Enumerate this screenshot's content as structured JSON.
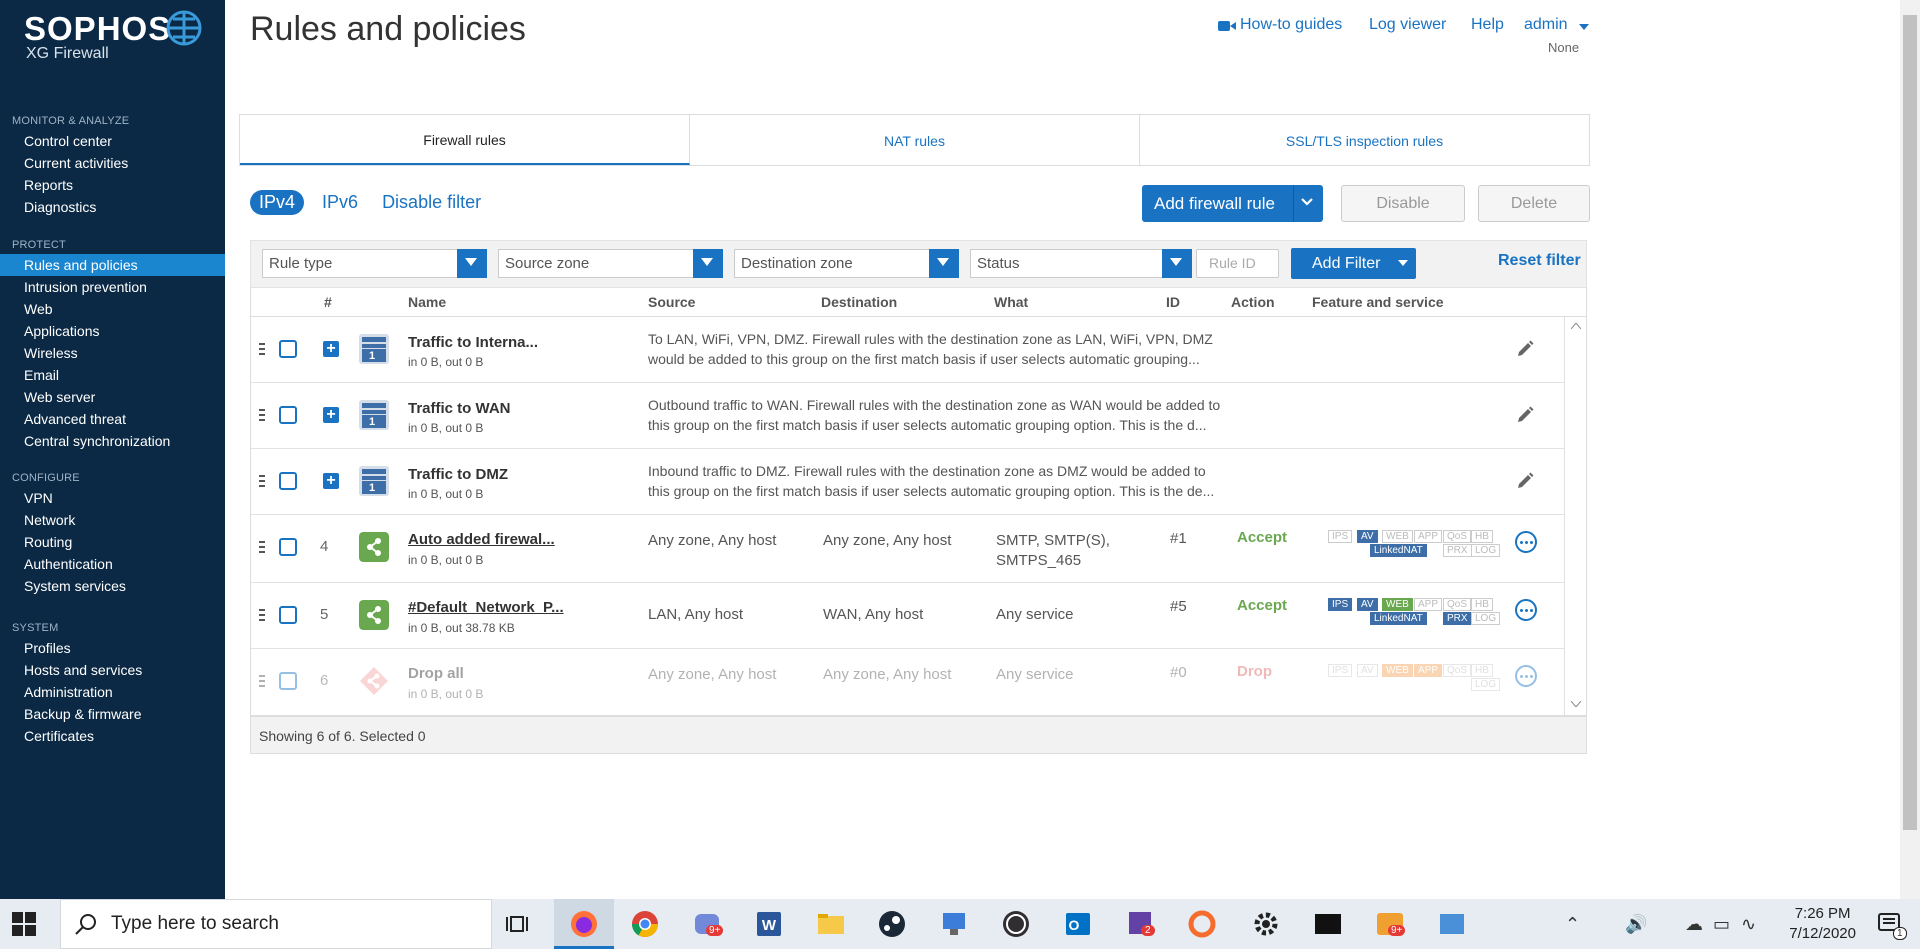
{
  "brand": {
    "name": "SOPHOS",
    "product": "XG Firewall"
  },
  "sidebar": {
    "sections": [
      {
        "head": "MONITOR & ANALYZE",
        "items": [
          "Control center",
          "Current activities",
          "Reports",
          "Diagnostics"
        ]
      },
      {
        "head": "PROTECT",
        "items": [
          "Rules and policies",
          "Intrusion prevention",
          "Web",
          "Applications",
          "Wireless",
          "Email",
          "Web server",
          "Advanced threat",
          "Central synchronization"
        ]
      },
      {
        "head": "CONFIGURE",
        "items": [
          "VPN",
          "Network",
          "Routing",
          "Authentication",
          "System services"
        ]
      },
      {
        "head": "SYSTEM",
        "items": [
          "Profiles",
          "Hosts and services",
          "Administration",
          "Backup & firmware",
          "Certificates"
        ]
      }
    ],
    "active": "Rules and policies"
  },
  "header": {
    "title": "Rules and policies",
    "links": [
      "How-to guides",
      "Log viewer",
      "Help",
      "admin"
    ],
    "sub": "None"
  },
  "tabs": [
    "Firewall rules",
    "NAT rules",
    "SSL/TLS inspection rules"
  ],
  "toolbar": {
    "ipv4": "IPv4",
    "ipv6": "IPv6",
    "disable_filter": "Disable filter",
    "add_rule": "Add firewall rule",
    "disable": "Disable",
    "delete": "Delete"
  },
  "filters": {
    "rule_type": "Rule type",
    "source_zone": "Source zone",
    "destination_zone": "Destination zone",
    "status": "Status",
    "rule_id_placeholder": "Rule ID",
    "add_filter": "Add Filter",
    "reset": "Reset filter"
  },
  "columns": [
    "#",
    "Name",
    "Source",
    "Destination",
    "What",
    "ID",
    "Action",
    "Feature and service"
  ],
  "groups": [
    {
      "name": "Traffic to Interna...",
      "stats": "in 0 B, out 0 B",
      "desc1": "To LAN, WiFi, VPN, DMZ. Firewall rules with the destination zone as LAN, WiFi, VPN, DMZ",
      "desc2": "would be added to this group on the first match basis if user selects automatic grouping..."
    },
    {
      "name": "Traffic to WAN",
      "stats": "in 0 B, out 0 B",
      "desc1": "Outbound traffic to WAN. Firewall rules with the destination zone as WAN would be added to",
      "desc2": "this group on the first match basis if user selects automatic grouping option. This is the d..."
    },
    {
      "name": "Traffic to DMZ",
      "stats": "in 0 B, out 0 B",
      "desc1": "Inbound traffic to DMZ. Firewall rules with the destination zone as DMZ would be added to",
      "desc2": "this group on the first match basis if user selects automatic grouping option. This is the de..."
    }
  ],
  "group_badge": "1",
  "rules": [
    {
      "num": "4",
      "name": "Auto added firewal...",
      "stats": "in 0 B, out 0 B",
      "source": "Any zone, Any host",
      "destination": "Any zone, Any host",
      "what1": "SMTP, SMTP(S),",
      "what2": "SMTPS_465",
      "id": "#1",
      "action": "Accept"
    },
    {
      "num": "5",
      "name": "#Default_Network_P...",
      "stats": "in 0 B, out 38.78 KB",
      "source": "LAN, Any host",
      "destination": "WAN, Any host",
      "what1": "Any service",
      "what2": "",
      "id": "#5",
      "action": "Accept"
    },
    {
      "num": "6",
      "name": "Drop all",
      "stats": "in 0 B, out 0 B",
      "source": "Any zone, Any host",
      "destination": "Any zone, Any host",
      "what1": "Any service",
      "what2": "",
      "id": "#0",
      "action": "Drop"
    }
  ],
  "badge_labels": {
    "ips": "IPS",
    "av": "AV",
    "web": "WEB",
    "app": "APP",
    "qos": "QoS",
    "hb": "HB",
    "linkednat": "LinkedNAT",
    "prx": "PRX",
    "log": "LOG"
  },
  "footer": "Showing 6 of 6. Selected 0",
  "taskbar": {
    "search_placeholder": "Type here to search",
    "time": "7:26 PM",
    "date": "7/12/2020",
    "badge_9": "9+",
    "badge_2": "2",
    "notif_count": "1"
  },
  "colors": {
    "sidebar": "#0b2944",
    "accent": "#1a73c2",
    "accept": "#6aa84f",
    "drop": "#e06666"
  }
}
